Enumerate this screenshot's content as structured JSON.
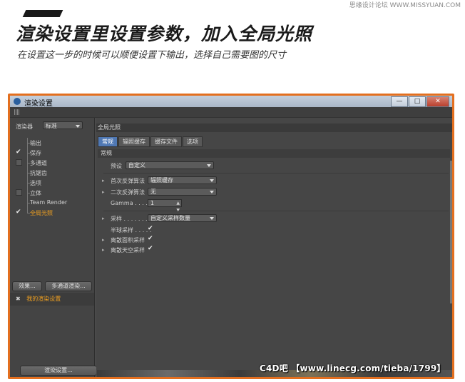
{
  "page": {
    "top_credit": "思缘设计论坛 WWW.MISSYUAN.COM",
    "headline": "渲染设置里设置参数，加入全局光照",
    "subline": "在设置这一步的时候可以顺便设置下输出，选择自己需要图的尺寸",
    "watermark": "C4D吧 【www.linecg.com/tieba/1799】"
  },
  "window": {
    "title": "渲染设置",
    "buttons": {
      "minimize": "—",
      "maximize": "□",
      "close": "✕"
    }
  },
  "left": {
    "renderer_label": "渲染器",
    "renderer_value": "标准",
    "tree": [
      {
        "label": "输出",
        "check": "none"
      },
      {
        "label": "保存",
        "check": "tick"
      },
      {
        "label": "多通道",
        "check": "box"
      },
      {
        "label": "抗锯齿",
        "check": "none"
      },
      {
        "label": "选项",
        "check": "none"
      },
      {
        "label": "立体",
        "check": "box"
      },
      {
        "label": "Team Render",
        "check": "none"
      },
      {
        "label": "全局光照",
        "check": "tick",
        "active": true
      }
    ],
    "effects_button": "效果...",
    "multipass_button": "多通道渲染...",
    "preset_item": "我的渲染设置",
    "preset_icon": "✖",
    "render_settings_button": "渲染设置..."
  },
  "right": {
    "panel_title": "全局光照",
    "tabs": [
      "常规",
      "辐照缓存",
      "缓存文件",
      "选项"
    ],
    "section": "常规",
    "preset_label": "预设",
    "preset_value": "自定义",
    "primary_label": "首次反弹算法",
    "primary_value": "辐照缓存",
    "secondary_label": "二次反弹算法",
    "secondary_value": "无",
    "gamma_label": "Gamma . . . . .",
    "gamma_value": "1",
    "sampling_label": "采样 . . . . . . .",
    "sampling_value": "自定义采样数量",
    "hemi_label": "半球采样 . . . . .",
    "discrete_area_label": "离散面积采样",
    "discrete_sky_label": "离散天空采样",
    "check_mark": "✔",
    "arrow": "▸"
  }
}
